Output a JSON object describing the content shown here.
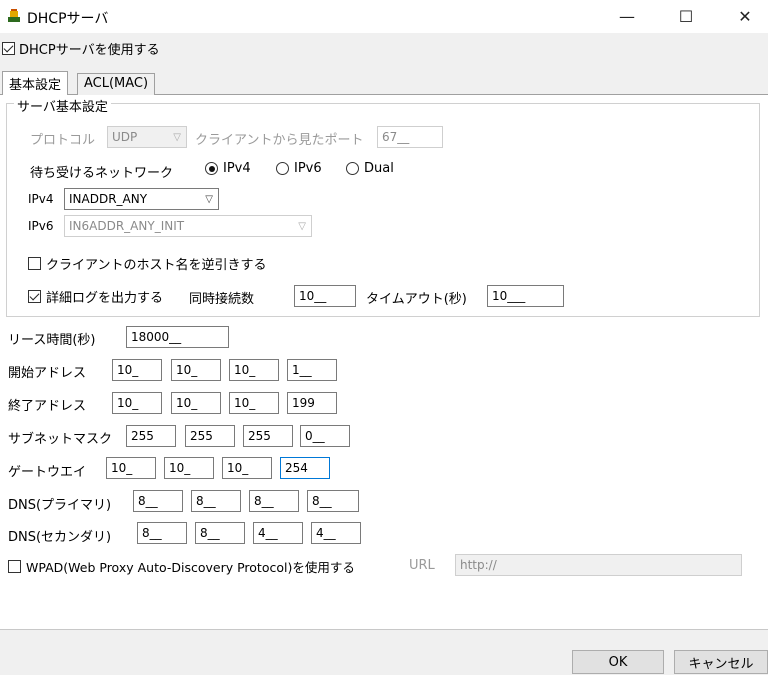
{
  "window": {
    "title": "DHCPサーバ",
    "minimize": "—",
    "maximize": "☐",
    "close": "✕"
  },
  "enable_checkbox": {
    "label": "DHCPサーバを使用する",
    "checked": true
  },
  "tabs": [
    {
      "label": "基本設定",
      "active": true
    },
    {
      "label": "ACL(MAC)",
      "active": false
    }
  ],
  "group": {
    "title": "サーバ基本設定",
    "protocol_label": "プロトコル",
    "protocol_value": "UDP",
    "port_label": "クライアントから見たポート",
    "port_value": "67__",
    "network_label": "待ち受けるネットワーク",
    "network_options": [
      "IPv4",
      "IPv6",
      "Dual"
    ],
    "network_selected": "IPv4",
    "ipv4_label": "IPv4",
    "ipv4_value": "INADDR_ANY",
    "ipv6_label": "IPv6",
    "ipv6_value": "IN6ADDR_ANY_INIT",
    "reverse_lookup_label": "クライアントのホスト名を逆引きする",
    "detail_log_label": "詳細ログを出力する",
    "concurrent_label": "同時接続数",
    "concurrent_value": "10__",
    "timeout_label": "タイムアウト(秒)",
    "timeout_value": "10___"
  },
  "lease": {
    "label": "リース時間(秒)",
    "value": "18000__"
  },
  "start_address": {
    "label": "開始アドレス",
    "octets": [
      "10_",
      "10_",
      "10_",
      "1__"
    ]
  },
  "end_address": {
    "label": "終了アドレス",
    "octets": [
      "10_",
      "10_",
      "10_",
      "199"
    ]
  },
  "subnet_mask": {
    "label": "サブネットマスク",
    "octets": [
      "255",
      "255",
      "255",
      "0__"
    ]
  },
  "gateway": {
    "label": "ゲートウエイ",
    "octets": [
      "10_",
      "10_",
      "10_",
      "254"
    ]
  },
  "dns_primary": {
    "label": "DNS(プライマリ)",
    "octets": [
      "8__",
      "8__",
      "8__",
      "8__"
    ]
  },
  "dns_secondary": {
    "label": "DNS(セカンダリ)",
    "octets": [
      "8__",
      "8__",
      "4__",
      "4__"
    ]
  },
  "wpad": {
    "label": "WPAD(Web Proxy Auto-Discovery Protocol)を使用する",
    "url_label": "URL",
    "url_value": "http://"
  },
  "buttons": {
    "ok": "OK",
    "cancel": "キャンセル"
  },
  "colors": {
    "focus": "#0078d7",
    "panel": "#ffffff",
    "window": "#f0f0f0"
  }
}
